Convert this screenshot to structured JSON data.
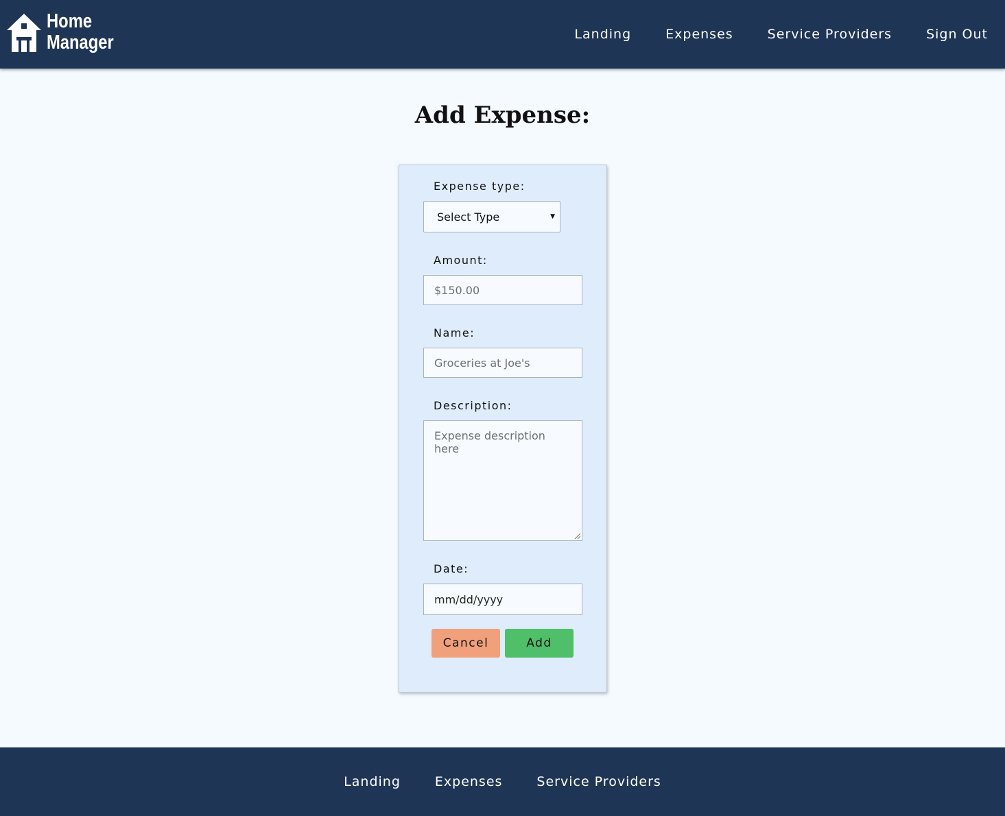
{
  "header": {
    "logo_line1": "Home",
    "logo_line2": "Manager",
    "logo_icon": "house-icon",
    "nav": [
      "Landing",
      "Expenses",
      "Service Providers",
      "Sign Out"
    ]
  },
  "page": {
    "title": "Add Expense:"
  },
  "form": {
    "expense_type_label": "Expense type:",
    "expense_type_value": "Select Type",
    "amount_label": "Amount:",
    "amount_placeholder": "$150.00",
    "name_label": "Name:",
    "name_placeholder": "Groceries at Joe's",
    "description_label": "Description:",
    "description_placeholder": "Expense description here",
    "date_label": "Date:",
    "date_placeholder": "mm/dd/yyyy",
    "cancel_label": "Cancel",
    "add_label": "Add"
  },
  "footer": {
    "nav": [
      "Landing",
      "Expenses",
      "Service Providers"
    ]
  },
  "colors": {
    "nav_background": "#1f3556",
    "page_background": "#f5faff",
    "card_background": "#dfecfc",
    "cancel_button": "#f0a07a",
    "add_button": "#4fbf69"
  }
}
